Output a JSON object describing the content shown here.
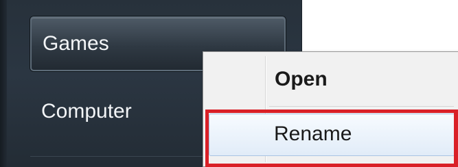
{
  "start_panel": {
    "items": [
      {
        "label": "Games"
      },
      {
        "label": "Computer"
      }
    ]
  },
  "context_menu": {
    "items": [
      {
        "label": "Open"
      },
      {
        "label": "Rename"
      }
    ]
  },
  "colors": {
    "panel_bg": "#2b3642",
    "menu_bg": "#f1f1f1",
    "highlight_border": "#d92027",
    "hover_bg": "#e1ecf8"
  }
}
